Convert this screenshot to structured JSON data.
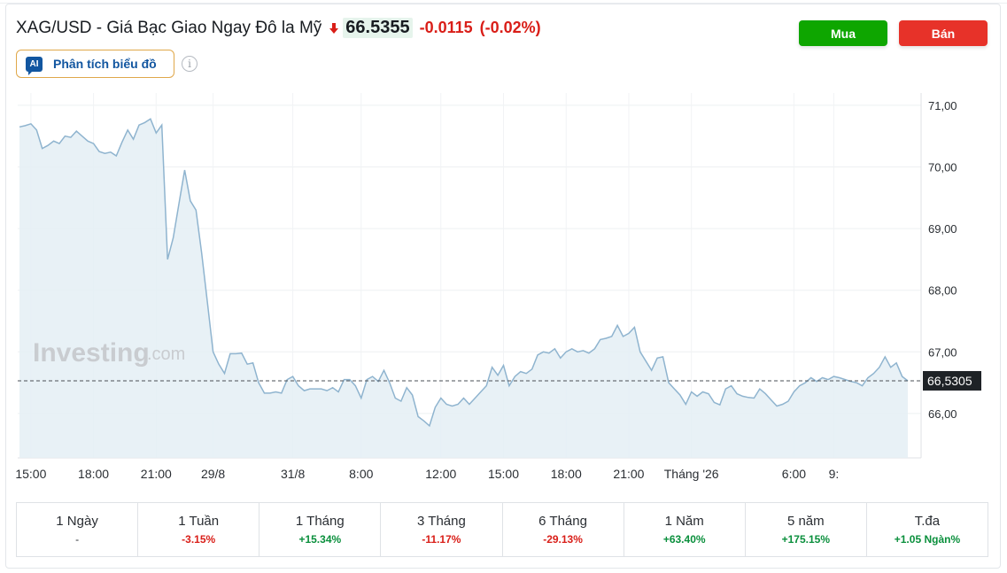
{
  "instrument": {
    "title": "XAG/USD - Giá Bạc Giao Ngay Đô la Mỹ",
    "price": "66.5355",
    "change": "-0.0115",
    "change_pct": "(-0.02%)",
    "direction": "down"
  },
  "actions": {
    "buy_label": "Mua",
    "sell_label": "Bán",
    "ai_badge": "AI",
    "ai_label": "Phân tích biểu đồ",
    "info_icon": "i"
  },
  "colors": {
    "buy": "#0ea600",
    "sell": "#e73229",
    "line": "#8fb4cf",
    "area": "#e4eef5",
    "up": "#0a8f3c",
    "down": "#d91e18"
  },
  "chart_data": {
    "type": "area",
    "watermark_main": "Investing",
    "watermark_suffix": ".com",
    "y_ticks": [
      "71,00",
      "70,00",
      "69,00",
      "68,00",
      "67,00",
      "66,00"
    ],
    "y_tick_values": [
      71,
      70,
      69,
      68,
      67,
      66
    ],
    "ylim": [
      65.28,
      71.2
    ],
    "x_ticks": [
      "15:00",
      "18:00",
      "21:00",
      "29/8",
      "31/8",
      "8:00",
      "12:00",
      "15:00",
      "18:00",
      "21:00",
      "Tháng '26",
      "6:00",
      "9:"
    ],
    "x_tick_index": [
      2,
      13,
      24,
      34,
      48,
      60,
      74,
      85,
      96,
      107,
      118,
      136,
      143
    ],
    "current_value": 66.5305,
    "current_label": "66,5305",
    "grid": true,
    "values": [
      70.65,
      70.67,
      70.7,
      70.6,
      70.3,
      70.35,
      70.42,
      70.38,
      70.5,
      70.48,
      70.58,
      70.5,
      70.42,
      70.38,
      70.25,
      70.22,
      70.24,
      70.18,
      70.4,
      70.6,
      70.45,
      70.68,
      70.72,
      70.78,
      70.55,
      70.68,
      68.5,
      68.85,
      69.4,
      69.95,
      69.45,
      69.3,
      68.6,
      67.8,
      67.0,
      66.8,
      66.65,
      66.97,
      66.97,
      66.98,
      66.8,
      66.82,
      66.5,
      66.33,
      66.33,
      66.35,
      66.33,
      66.55,
      66.6,
      66.45,
      66.37,
      66.4,
      66.4,
      66.4,
      66.37,
      66.42,
      66.35,
      66.55,
      66.55,
      66.45,
      66.25,
      66.55,
      66.6,
      66.52,
      66.7,
      66.5,
      66.25,
      66.2,
      66.42,
      66.3,
      65.95,
      65.88,
      65.8,
      66.1,
      66.25,
      66.15,
      66.12,
      66.15,
      66.25,
      66.15,
      66.25,
      66.35,
      66.45,
      66.75,
      66.62,
      66.78,
      66.45,
      66.6,
      66.68,
      66.65,
      66.72,
      66.95,
      67.0,
      66.98,
      67.05,
      66.9,
      67.0,
      67.05,
      67.0,
      67.02,
      66.98,
      67.05,
      67.2,
      67.22,
      67.25,
      67.43,
      67.25,
      67.3,
      67.4,
      67.0,
      66.85,
      66.7,
      66.9,
      66.92,
      66.5,
      66.4,
      66.3,
      66.15,
      66.35,
      66.28,
      66.35,
      66.32,
      66.18,
      66.14,
      66.4,
      66.45,
      66.32,
      66.28,
      66.26,
      66.25,
      66.4,
      66.32,
      66.22,
      66.12,
      66.15,
      66.2,
      66.35,
      66.45,
      66.5,
      66.58,
      66.52,
      66.58,
      66.55,
      66.6,
      66.58,
      66.55,
      66.52,
      66.5,
      66.45,
      66.58,
      66.65,
      66.75,
      66.92,
      66.75,
      66.82,
      66.6,
      66.53
    ]
  },
  "periods": [
    {
      "label": "1 Ngày",
      "value": "-",
      "trend": "flat"
    },
    {
      "label": "1 Tuần",
      "value": "-3.15%",
      "trend": "down"
    },
    {
      "label": "1 Tháng",
      "value": "+15.34%",
      "trend": "up"
    },
    {
      "label": "3 Tháng",
      "value": "-11.17%",
      "trend": "down"
    },
    {
      "label": "6 Tháng",
      "value": "-29.13%",
      "trend": "down"
    },
    {
      "label": "1 Năm",
      "value": "+63.40%",
      "trend": "up"
    },
    {
      "label": "5 năm",
      "value": "+175.15%",
      "trend": "up"
    },
    {
      "label": "T.đa",
      "value": "+1.05 Ngàn%",
      "trend": "up"
    }
  ]
}
